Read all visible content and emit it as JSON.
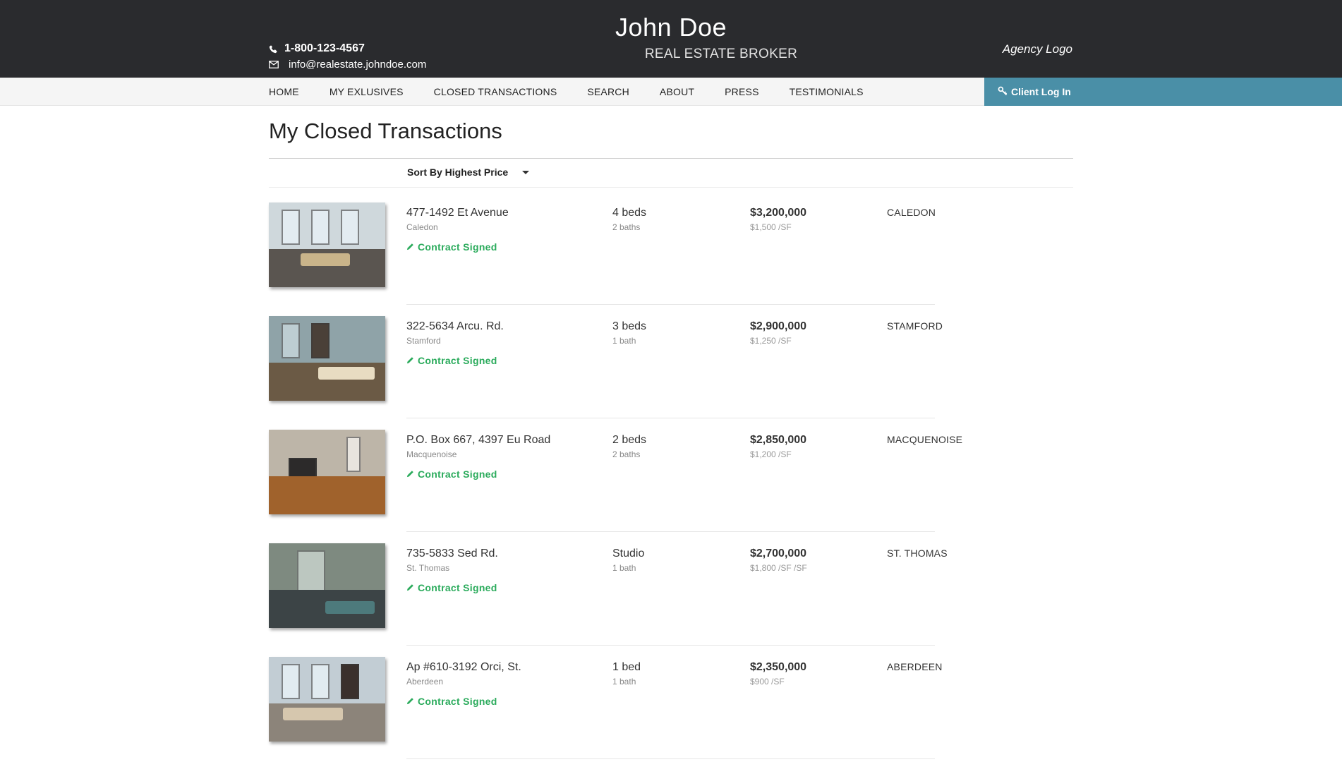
{
  "header": {
    "phone": "1-800-123-4567",
    "email": "info@realestate.johndoe.com",
    "name": "John Doe",
    "role": "REAL ESTATE BROKER",
    "agency": "Agency Logo",
    "background_color": "#2a2b2e"
  },
  "nav": {
    "items": [
      {
        "label": "HOME"
      },
      {
        "label": "MY EXLUSIVES"
      },
      {
        "label": "CLOSED TRANSACTIONS"
      },
      {
        "label": "SEARCH"
      },
      {
        "label": "ABOUT"
      },
      {
        "label": "PRESS"
      },
      {
        "label": "TESTIMONIALS"
      }
    ],
    "login_label": "Client Log In",
    "login_color": "#4a8fa7"
  },
  "main": {
    "title": "My Closed Transactions",
    "sort_label": "Sort By Highest Price",
    "status_color": "#2bab5c",
    "listings": [
      {
        "address": "477-1492 Et Avenue",
        "city": "Caledon",
        "status": "Contract Signed",
        "beds": "4 beds",
        "baths": "2 baths",
        "price": "$3,200,000",
        "ppsf": "$1,500 /SF",
        "city_caps": "CALEDON"
      },
      {
        "address": "322-5634 Arcu. Rd.",
        "city": "Stamford",
        "status": "Contract Signed",
        "beds": "3 beds",
        "baths": "1 bath",
        "price": "$2,900,000",
        "ppsf": "$1,250 /SF",
        "city_caps": "STAMFORD"
      },
      {
        "address": "P.O. Box 667, 4397 Eu Road",
        "city": "Macquenoise",
        "status": "Contract Signed",
        "beds": "2 beds",
        "baths": "2 baths",
        "price": "$2,850,000",
        "ppsf": "$1,200 /SF",
        "city_caps": "MACQUENOISE"
      },
      {
        "address": "735-5833 Sed Rd.",
        "city": "St. Thomas",
        "status": "Contract Signed",
        "beds": "Studio",
        "baths": "1 bath",
        "price": "$2,700,000",
        "ppsf": "$1,800 /SF /SF",
        "city_caps": "ST. THOMAS"
      },
      {
        "address": "Ap #610-3192 Orci, St.",
        "city": "Aberdeen",
        "status": "Contract Signed",
        "beds": "1 bed",
        "baths": "1 bath",
        "price": "$2,350,000",
        "ppsf": "$900 /SF",
        "city_caps": "ABERDEEN"
      }
    ]
  }
}
